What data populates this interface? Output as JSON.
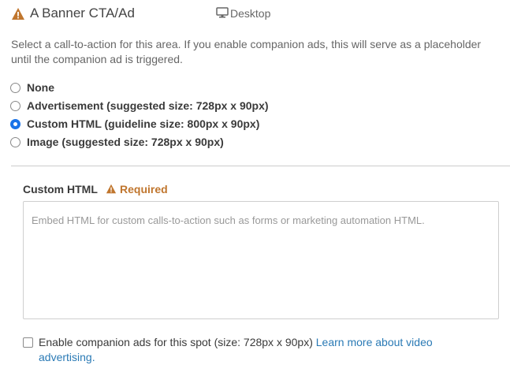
{
  "header": {
    "title": "A Banner CTA/Ad",
    "device_label": "Desktop",
    "warning_icon": "warning-triangle-icon",
    "device_icon": "monitor-icon"
  },
  "description": "Select a call-to-action for this area. If you enable companion ads, this will serve as a placeholder until the companion ad is triggered.",
  "options": [
    {
      "label": "None",
      "checked": false
    },
    {
      "label": "Advertisement (suggested size: 728px x 90px)",
      "checked": false
    },
    {
      "label": "Custom HTML (guideline size: 800px x 90px)",
      "checked": true
    },
    {
      "label": "Image (suggested size: 728px x 90px)",
      "checked": false
    }
  ],
  "custom_html": {
    "label": "Custom HTML",
    "required_label": "Required",
    "value": "",
    "placeholder": "Embed HTML for custom calls-to-action such as forms or marketing automation HTML."
  },
  "companion": {
    "checked": false,
    "label": "Enable companion ads for this spot (size: 728px x 90px)",
    "link_text": "Learn more about video advertising."
  },
  "colors": {
    "warning": "#c0762e",
    "accent": "#1a73e8",
    "link": "#2a7ab5"
  }
}
